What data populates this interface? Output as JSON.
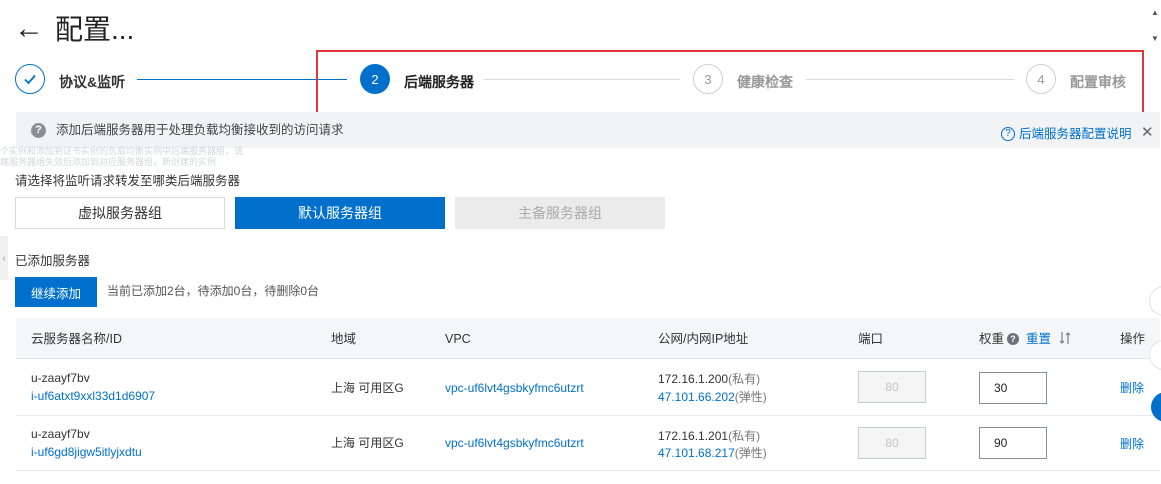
{
  "header": {
    "back_icon": "arrow-left-icon",
    "title": "配置..."
  },
  "steps": [
    {
      "number": "",
      "label": "协议&监听",
      "state": "done"
    },
    {
      "number": "2",
      "label": "后端服务器",
      "state": "active"
    },
    {
      "number": "3",
      "label": "健康检查",
      "state": "todo"
    },
    {
      "number": "4",
      "label": "配置审核",
      "state": "todo"
    }
  ],
  "info": {
    "text": "添加后端服务器用于处理负载均衡接收到的访问请求",
    "help_link": "后端服务器配置说明",
    "ghost_line1": "个实例和添加到证书实例的负载均衡实例中后端服务器组，请",
    "ghost_line2": "端服务器组失效后添加到对应服务器组，新创建的实例"
  },
  "server_type": {
    "prompt": "请选择将监听请求转发至哪类后端服务器",
    "options": [
      "虚拟服务器组",
      "默认服务器组",
      "主备服务器组"
    ],
    "selected": "默认服务器组"
  },
  "added": {
    "label": "已添加服务器",
    "continue_button": "继续添加",
    "count_text": "当前已添加2台，待添加0台，待删除0台"
  },
  "table": {
    "columns": {
      "name": "云服务器名称/ID",
      "region": "地域",
      "vpc": "VPC",
      "ip": "公网/内网IP地址",
      "port": "端口",
      "weight": "权重",
      "weight_reset": "重置",
      "action": "操作"
    },
    "rows": [
      {
        "name": "u-zaayf7bv",
        "id": "i-uf6atxt9xxl33d1d6907",
        "region": "上海 可用区G",
        "vpc": "vpc-uf6lvt4gsbkyfmc6utzrt",
        "private_ip": "172.16.1.200",
        "private_tag": "(私有)",
        "public_ip": "47.101.66.202",
        "public_tag": "(弹性)",
        "port_placeholder": "80",
        "weight": "30",
        "action": "删除"
      },
      {
        "name": "u-zaayf7bv",
        "id": "i-uf6gd8jigw5itlyjxdtu",
        "region": "上海 可用区G",
        "vpc": "vpc-uf6lvt4gsbkyfmc6utzrt",
        "private_ip": "172.16.1.201",
        "private_tag": "(私有)",
        "public_ip": "47.101.68.217",
        "public_tag": "(弹性)",
        "port_placeholder": "80",
        "weight": "90",
        "action": "删除"
      }
    ]
  },
  "colors": {
    "accent": "#0070cc",
    "highlight": "#e0363d"
  }
}
